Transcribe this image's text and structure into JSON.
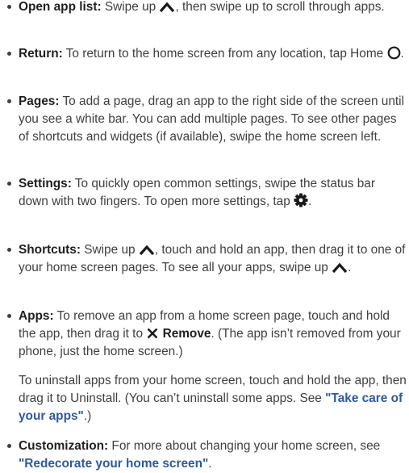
{
  "items": [
    {
      "term": "Open app list:",
      "parts": [
        " Swipe up ",
        ", then swipe up to scroll through apps."
      ],
      "icons": [
        "chevron-up-icon"
      ]
    },
    {
      "term": "Return:",
      "parts": [
        " To return to the home screen from any location, tap Home ",
        "."
      ],
      "icons": [
        "home-circle-icon"
      ]
    },
    {
      "term": "Pages:",
      "text": " To add a page, drag an app to the right side of the screen until you see a white bar. You can add multiple pages. To see other pages of shortcuts and widgets (if available), swipe the home screen left."
    },
    {
      "term": "Settings:",
      "parts": [
        " To quickly open common settings, swipe the status bar down with two fingers. To open more settings, tap ",
        "."
      ],
      "icons": [
        "gear-icon"
      ]
    },
    {
      "term": "Shortcuts:",
      "parts": [
        " Swipe up ",
        ", touch and hold an app, then drag it to one of your home screen pages. To see all your apps, swipe up ",
        "."
      ],
      "icons": [
        "chevron-up-icon",
        "chevron-up-icon"
      ]
    },
    {
      "term": "Apps:",
      "parts": [
        " To remove an app from a home screen page, touch and hold the app, then drag it to ",
        " ",
        ". (The app isn’t removed from your phone, just the home screen.)"
      ],
      "icons": [
        "close-x-icon"
      ],
      "bold_word": "Remove"
    },
    {
      "note_parts": [
        "To uninstall apps from your home screen, touch and hold the app, then drag it to Uninstall. (You can’t uninstall some apps. See ",
        ".)"
      ],
      "link": "\"Take care of your apps\""
    },
    {
      "term": "Customization:",
      "parts": [
        " For more about changing your home screen, see ",
        "."
      ],
      "link": "\"Redecorate your home screen\""
    }
  ]
}
